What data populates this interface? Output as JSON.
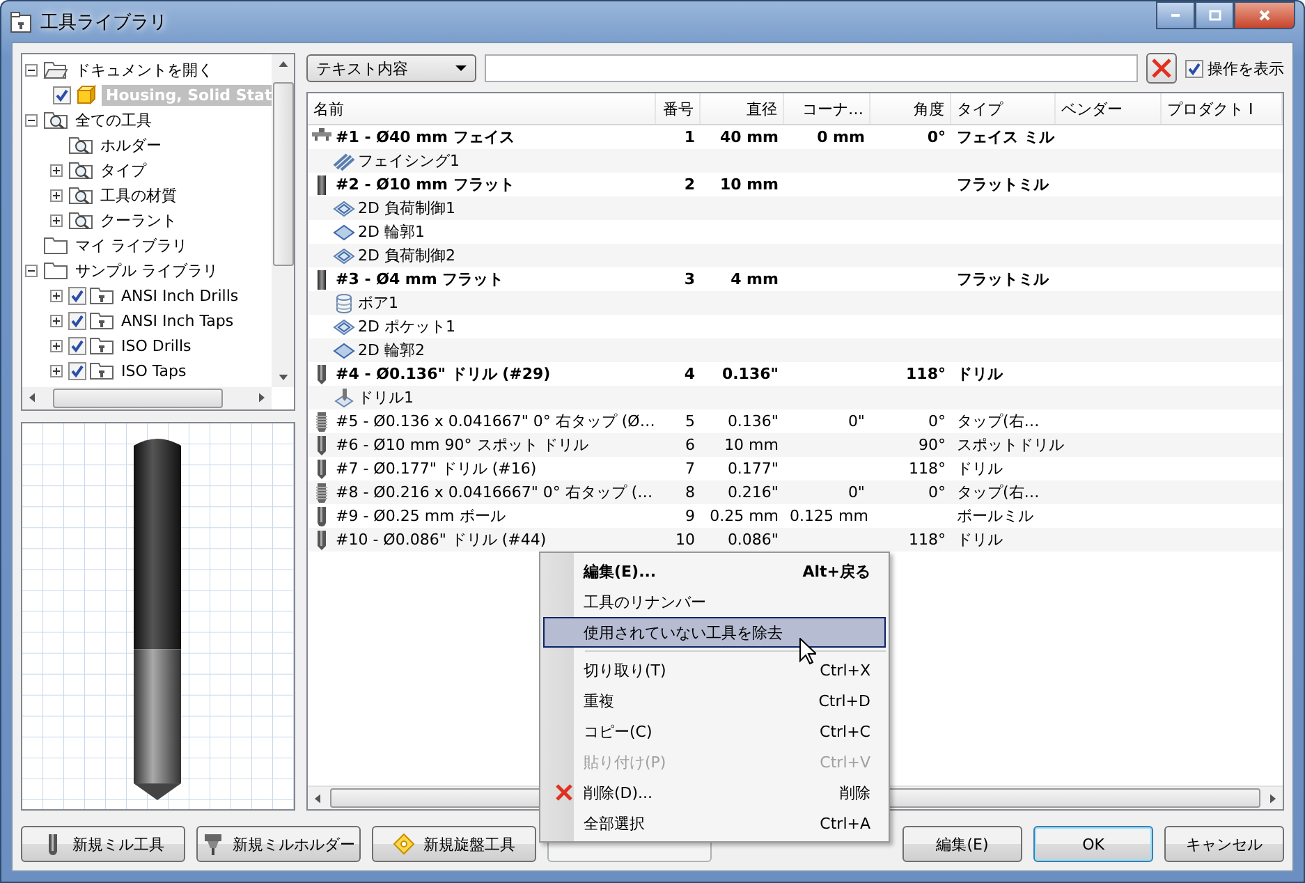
{
  "window": {
    "title": "工具ライブラリ"
  },
  "tree": [
    {
      "label": "ドキュメントを開く",
      "kind": "document",
      "expanded": true,
      "selected": false,
      "children": [
        {
          "label": "Housing, Solid Stat",
          "kind": "part",
          "checked": true,
          "selected": true
        }
      ]
    },
    {
      "label": "全ての工具",
      "kind": "search",
      "expanded": true,
      "selected": false,
      "children": [
        {
          "label": "ホルダー",
          "kind": "search",
          "selected": false
        },
        {
          "label": "タイプ",
          "kind": "search",
          "expanded": false,
          "selected": false
        },
        {
          "label": "工具の材質",
          "kind": "search",
          "expanded": false,
          "selected": false
        },
        {
          "label": "クーラント",
          "kind": "search",
          "expanded": false,
          "selected": false
        }
      ]
    },
    {
      "label": "マイ ライブラリ",
      "kind": "folder",
      "selected": false
    },
    {
      "label": "サンプル ライブラリ",
      "kind": "folder",
      "expanded": true,
      "selected": false,
      "children": [
        {
          "label": "ANSI Inch Drills",
          "kind": "library",
          "expanded": false,
          "checked": true,
          "selected": false
        },
        {
          "label": "ANSI Inch Taps",
          "kind": "library",
          "expanded": false,
          "checked": true,
          "selected": false
        },
        {
          "label": "ISO Drills",
          "kind": "library",
          "expanded": false,
          "checked": true,
          "selected": false
        },
        {
          "label": "ISO Taps",
          "kind": "library",
          "expanded": false,
          "checked": true,
          "selected": false
        }
      ]
    }
  ],
  "filter": {
    "dropdown": "テキスト内容",
    "show_operations": {
      "label": "操作を表示",
      "checked": true
    }
  },
  "table": {
    "columns": [
      "名前",
      "番号",
      "直径",
      "コーナ…",
      "角度",
      "タイプ",
      "ベンダー",
      "プロダクト I"
    ],
    "rows": [
      {
        "kind": "facemill",
        "bold": true,
        "name": "#1 - Ø40 mm フェイス",
        "number": "1",
        "diameter": "40 mm",
        "corner": "0 mm",
        "angle": "0°",
        "type": "フェイス ミル"
      },
      {
        "kind": "facing",
        "bold": false,
        "name": "フェイシング1"
      },
      {
        "kind": "flatmill",
        "bold": true,
        "name": "#2 - Ø10 mm フラット",
        "number": "2",
        "diameter": "10 mm",
        "type": "フラットミル"
      },
      {
        "kind": "adaptive",
        "bold": false,
        "name": "2D 負荷制御1"
      },
      {
        "kind": "contour",
        "bold": false,
        "name": "2D 輪郭1"
      },
      {
        "kind": "adaptive",
        "bold": false,
        "name": "2D 負荷制御2"
      },
      {
        "kind": "flatmill",
        "bold": true,
        "name": "#3 - Ø4 mm フラット",
        "number": "3",
        "diameter": "4 mm",
        "type": "フラットミル"
      },
      {
        "kind": "bore",
        "bold": false,
        "name": "ボア1"
      },
      {
        "kind": "adaptive",
        "bold": false,
        "name": "2D ポケット1"
      },
      {
        "kind": "contour",
        "bold": false,
        "name": "2D 輪郭2"
      },
      {
        "kind": "drill",
        "bold": true,
        "name": "#4 - Ø0.136\" ドリル (#29)",
        "number": "4",
        "diameter": "0.136\"",
        "angle": "118°",
        "type": "ドリル"
      },
      {
        "kind": "drilling",
        "bold": false,
        "name": "ドリル1"
      },
      {
        "kind": "tap",
        "bold": false,
        "name": "#5 - Ø0.136 x 0.041667\" 0° 右タップ (Ø…",
        "number": "5",
        "diameter": "0.136\"",
        "corner": "0\"",
        "angle": "0°",
        "type": "タップ(右…"
      },
      {
        "kind": "drill",
        "bold": false,
        "name": "#6 - Ø10 mm 90° スポット ドリル",
        "number": "6",
        "diameter": "10 mm",
        "angle": "90°",
        "type": "スポットドリル"
      },
      {
        "kind": "drill",
        "bold": false,
        "name": "#7 - Ø0.177\" ドリル (#16)",
        "number": "7",
        "diameter": "0.177\"",
        "angle": "118°",
        "type": "ドリル"
      },
      {
        "kind": "tap",
        "bold": false,
        "name": "#8 - Ø0.216 x 0.0416667\" 0° 右タップ (…",
        "number": "8",
        "diameter": "0.216\"",
        "corner": "0\"",
        "angle": "0°",
        "type": "タップ(右…"
      },
      {
        "kind": "ballmill",
        "bold": false,
        "name": "#9 - Ø0.25 mm ボール",
        "number": "9",
        "diameter": "0.25 mm",
        "corner": "0.125 mm",
        "type": "ボールミル"
      },
      {
        "kind": "drill",
        "bold": false,
        "name": "#10 - Ø0.086\" ドリル (#44)",
        "number": "10",
        "diameter": "0.086\"",
        "angle": "118°",
        "type": "ドリル"
      }
    ]
  },
  "context_menu": [
    {
      "kind": "item",
      "label": "編集(E)...",
      "shortcut": "Alt+戻る",
      "bold": true,
      "disabled": false,
      "selected": false
    },
    {
      "kind": "item",
      "label": "工具のリナンバー",
      "bold": false,
      "disabled": false,
      "selected": false
    },
    {
      "kind": "item",
      "label": "使用されていない工具を除去",
      "bold": false,
      "disabled": false,
      "selected": true
    },
    {
      "kind": "separator"
    },
    {
      "kind": "item",
      "label": "切り取り(T)",
      "shortcut": "Ctrl+X",
      "bold": false,
      "disabled": false,
      "selected": false
    },
    {
      "kind": "item",
      "label": "重複",
      "shortcut": "Ctrl+D",
      "bold": false,
      "disabled": false,
      "selected": false
    },
    {
      "kind": "item",
      "label": "コピー(C)",
      "shortcut": "Ctrl+C",
      "bold": false,
      "disabled": false,
      "selected": false
    },
    {
      "kind": "item",
      "label": "貼り付け(P)",
      "shortcut": "Ctrl+V",
      "bold": false,
      "disabled": true,
      "selected": false
    },
    {
      "kind": "delete",
      "label": "削除(D)...",
      "shortcut": "削除",
      "bold": false,
      "disabled": false,
      "selected": false
    },
    {
      "kind": "item",
      "label": "全部選択",
      "shortcut": "Ctrl+A",
      "bold": false,
      "disabled": false,
      "selected": false
    }
  ],
  "left_buttons": [
    {
      "kind": "mill",
      "label": "新規ミル工具",
      "disabled": false
    },
    {
      "kind": "holder",
      "label": "新規ミルホルダー",
      "disabled": false
    },
    {
      "kind": "lathe",
      "label": "新規旋盤工具",
      "disabled": false
    },
    {
      "disabled": true
    }
  ],
  "right_buttons": [
    {
      "label": "編集(E)",
      "default": false
    },
    {
      "label": "OK",
      "default": true
    },
    {
      "label": "キャンセル",
      "default": false
    }
  ]
}
